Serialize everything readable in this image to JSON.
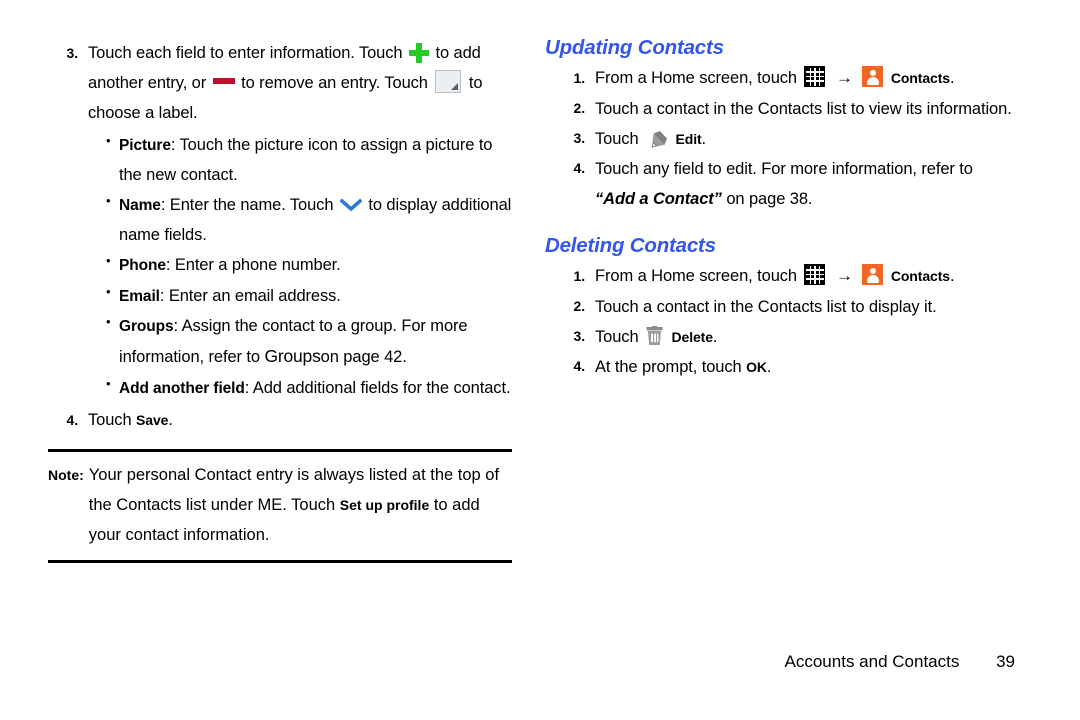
{
  "colors": {
    "heading_blue": "#3355EE",
    "plus_green": "#22CC22",
    "minus_red": "#C20E2E",
    "contacts_orange": "#F26522",
    "chevron_blue": "#2B7BD6",
    "icon_gray": "#808080"
  },
  "left_column": {
    "step3": {
      "number": "3.",
      "text_part1": "Touch each field to enter information. Touch",
      "text_part2": "to add another entry, or",
      "text_part3": "to remove an entry. Touch",
      "text_part4": "to choose a label.",
      "icons": {
        "add": "plus-icon",
        "remove": "minus-icon",
        "label_chooser": "label-chooser-icon"
      }
    },
    "bullets": [
      {
        "term": "Picture",
        "text": ": Touch the picture icon to assign a picture to the new contact."
      },
      {
        "term": "Name",
        "text_before": ": Enter the name. Touch",
        "text_after": "to display additional name fields.",
        "icon": "chevron-down-icon"
      },
      {
        "term": "Phone",
        "text": ": Enter a phone number."
      },
      {
        "term": "Email",
        "text": ": Enter an email address."
      },
      {
        "term": "Groups",
        "text_before": ": Assign the contact to a group. For more information, refer to",
        "xref": "Groups",
        "text_after": "on page 42."
      },
      {
        "term": "Add another field",
        "text": ": Add additional fields for the contact."
      }
    ],
    "step4": {
      "number": "4.",
      "text_before": "Touch",
      "ui_label": "Save",
      "text_after": "."
    },
    "note": {
      "tag": "Note:",
      "text_before": "Your personal Contact entry is always listed at the top of the Contacts list under ME. Touch",
      "ui_label": "Set up profile",
      "text_after": "to add your contact information."
    }
  },
  "right_column": {
    "sections": [
      {
        "heading": "Updating Contacts",
        "steps": [
          {
            "number": "1.",
            "type": "home_screen",
            "text_before": "From a Home screen, touch",
            "apps_icon": "apps-grid-icon",
            "arrow": "→",
            "contacts_icon": "contacts-icon",
            "ui_label": "Contacts",
            "text_after": "."
          },
          {
            "number": "2.",
            "type": "plain",
            "text": "Touch a contact in the Contacts list to view its information."
          },
          {
            "number": "3.",
            "type": "icon_label",
            "text_before": "Touch",
            "icon": "pencil-edit-icon",
            "ui_label": "Edit",
            "text_after": "."
          },
          {
            "number": "4.",
            "type": "xref",
            "text_before": "Touch any field to edit. For more information, refer to",
            "xref": "“Add a Contact”",
            "text_after": "on page 38."
          }
        ]
      },
      {
        "heading": "Deleting Contacts",
        "steps": [
          {
            "number": "1.",
            "type": "home_screen",
            "text_before": "From a Home screen, touch",
            "apps_icon": "apps-grid-icon",
            "arrow": "→",
            "contacts_icon": "contacts-icon",
            "ui_label": "Contacts",
            "text_after": "."
          },
          {
            "number": "2.",
            "type": "plain",
            "text": "Touch a contact in the Contacts list to display it."
          },
          {
            "number": "3.",
            "type": "icon_label",
            "text_before": "Touch",
            "icon": "trash-delete-icon",
            "ui_label": "Delete",
            "text_after": "."
          },
          {
            "number": "4.",
            "type": "ok",
            "text_before": "At the prompt, touch",
            "ui_label": "OK",
            "text_after": "."
          }
        ]
      }
    ]
  },
  "footer": {
    "chapter": "Accounts and Contacts",
    "page_number": "39"
  }
}
